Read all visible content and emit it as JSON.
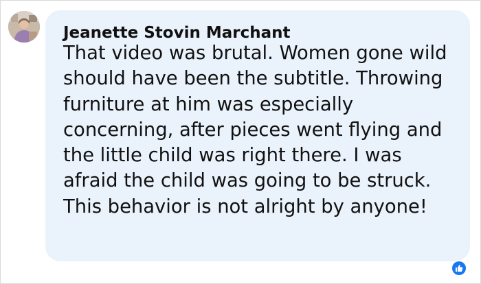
{
  "comment": {
    "author": "Jeanette Stovin Marchant",
    "text": "That video was brutal. Women gone wild should have been the subtitle. Throwing furniture at him was especially concerning, after pieces went flying and the little child was right there. I was afraid the child was going to be struck. This behavior is not alright by anyone!"
  },
  "reaction": {
    "icon": "like-icon",
    "color": "#1877f2"
  },
  "colors": {
    "bubble": "#eaf2fc",
    "text": "#111111"
  }
}
